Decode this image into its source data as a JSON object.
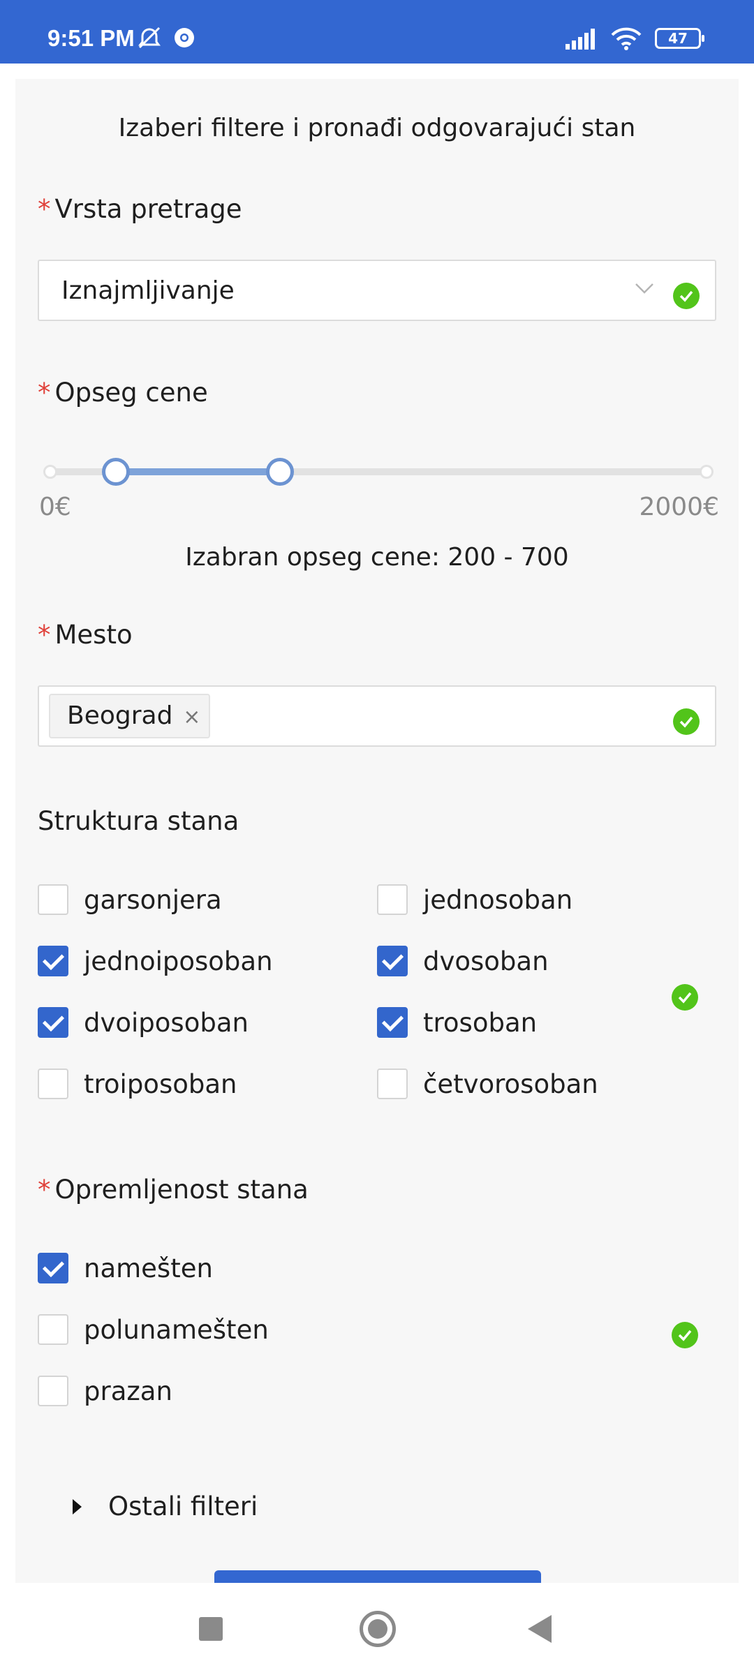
{
  "status_bar": {
    "time": "9:51 PM",
    "battery": "47",
    "icons": [
      "alarm-off-icon",
      "chrome-icon",
      "signal-icon",
      "wifi-icon",
      "battery-icon"
    ]
  },
  "form": {
    "heading": "Izaberi filtere i pronađi odgovarajući stan",
    "required_mark": "*",
    "search_type": {
      "label": "Vrsta pretrage",
      "value": "Iznajmljivanje"
    },
    "price_range": {
      "label": "Opseg cene",
      "min_label": "0€",
      "max_label": "2000€",
      "min": 0,
      "max": 2000,
      "selected_low": 200,
      "selected_high": 700,
      "selected_text": "Izabran opseg cene: 200 - 700"
    },
    "place": {
      "label": "Mesto",
      "tags": [
        "Beograd"
      ],
      "tag_close": "×"
    },
    "structure": {
      "label": "Struktura stana",
      "options": [
        {
          "label": "garsonjera",
          "checked": false
        },
        {
          "label": "jednosoban",
          "checked": false
        },
        {
          "label": "jednoiposoban",
          "checked": true
        },
        {
          "label": "dvosoban",
          "checked": true
        },
        {
          "label": "dvoiposoban",
          "checked": true
        },
        {
          "label": "trosoban",
          "checked": true
        },
        {
          "label": "troiposoban",
          "checked": false
        },
        {
          "label": "četvorosoban",
          "checked": false
        }
      ]
    },
    "furnishing": {
      "label": "Opremljenost stana",
      "options": [
        {
          "label": "namešten",
          "checked": true
        },
        {
          "label": "polunamešten",
          "checked": false
        },
        {
          "label": "prazan",
          "checked": false
        }
      ]
    },
    "more_filters": "Ostali filteri"
  },
  "colors": {
    "accent": "#3367d1",
    "success": "#52c41a",
    "required": "#e0423b"
  }
}
